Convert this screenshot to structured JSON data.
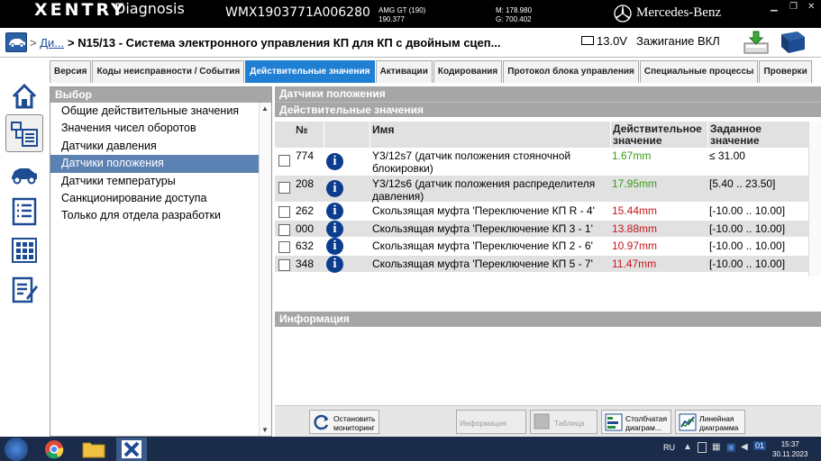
{
  "titlebar": {
    "brand": "XENTRY",
    "app": "Diagnosis",
    "vin": "WMX1903771A006280",
    "model_line1": "AMG GT (190)",
    "model_line2": "190.377",
    "m_line": "M: 178.980",
    "g_line": "G: 700.402",
    "maker": "Mercedes-Benz"
  },
  "topbar": {
    "crumb_link": "Ди...",
    "crumb_sep": ">",
    "crumb_current": "> N15/13 - Система электронного управления КП для КП с двойным сцеп...",
    "voltage": "13.0V",
    "ignition": "Зажигание ВКЛ"
  },
  "tabs": [
    {
      "label": "Версия"
    },
    {
      "label": "Коды неисправности / События"
    },
    {
      "label": "Действительные значения"
    },
    {
      "label": "Активации"
    },
    {
      "label": "Кодирования"
    },
    {
      "label": "Протокол блока управления"
    },
    {
      "label": "Специальные процессы"
    },
    {
      "label": "Проверки"
    }
  ],
  "left": {
    "header": "Выбор",
    "items": [
      {
        "label": "Общие действительные значения"
      },
      {
        "label": "Значения чисел оборотов"
      },
      {
        "label": "Датчики давления"
      },
      {
        "label": "Датчики положения"
      },
      {
        "label": "Датчики температуры"
      },
      {
        "label": "Санкционирование доступа"
      },
      {
        "label": "Только для отдела разработки"
      }
    ]
  },
  "right": {
    "header1": "Датчики положения",
    "header2": "Действительные значения",
    "columns": {
      "no": "№",
      "name": "Имя",
      "actual": "Действительное значение",
      "target": "Заданное значение"
    },
    "rows": [
      {
        "no": "774",
        "name": "Y3/12s7 (датчик положения стояночной блокировки)",
        "actual": "1.67mm",
        "target": "≤ 31.00",
        "status": "ok"
      },
      {
        "no": "208",
        "name": "Y3/12s6 (датчик положения распределителя давления)",
        "actual": "17.95mm",
        "target": "[5.40 .. 23.50]",
        "status": "ok"
      },
      {
        "no": "262",
        "name": "Скользящая муфта 'Переключение КП R - 4'",
        "actual": "15.44mm",
        "target": "[-10.00 .. 10.00]",
        "status": "bad"
      },
      {
        "no": "000",
        "name": "Скользящая муфта 'Переключение КП 3 - 1'",
        "actual": "13.88mm",
        "target": "[-10.00 .. 10.00]",
        "status": "bad"
      },
      {
        "no": "632",
        "name": "Скользящая муфта 'Переключение КП 2 - 6'",
        "actual": "10.97mm",
        "target": "[-10.00 .. 10.00]",
        "status": "bad"
      },
      {
        "no": "348",
        "name": "Скользящая муфта 'Переключение КП 5 - 7'",
        "actual": "11.47mm",
        "target": "[-10.00 .. 10.00]",
        "status": "bad"
      }
    ],
    "info_header": "Информация"
  },
  "buttons": {
    "stop_monitoring": "Остановить мониторинг",
    "information": "Информация",
    "table": "Таблица",
    "bar_chart": "Столбчатая диаграм...",
    "line_chart": "Линейная диаграмма"
  },
  "taskbar": {
    "lang": "RU",
    "time": "15:37",
    "date": "30.11.2023"
  },
  "colors": {
    "accent": "#1f7fd3",
    "selected_item": "#5b82b2",
    "ok": "#3a9b16",
    "error": "#c4161c"
  }
}
